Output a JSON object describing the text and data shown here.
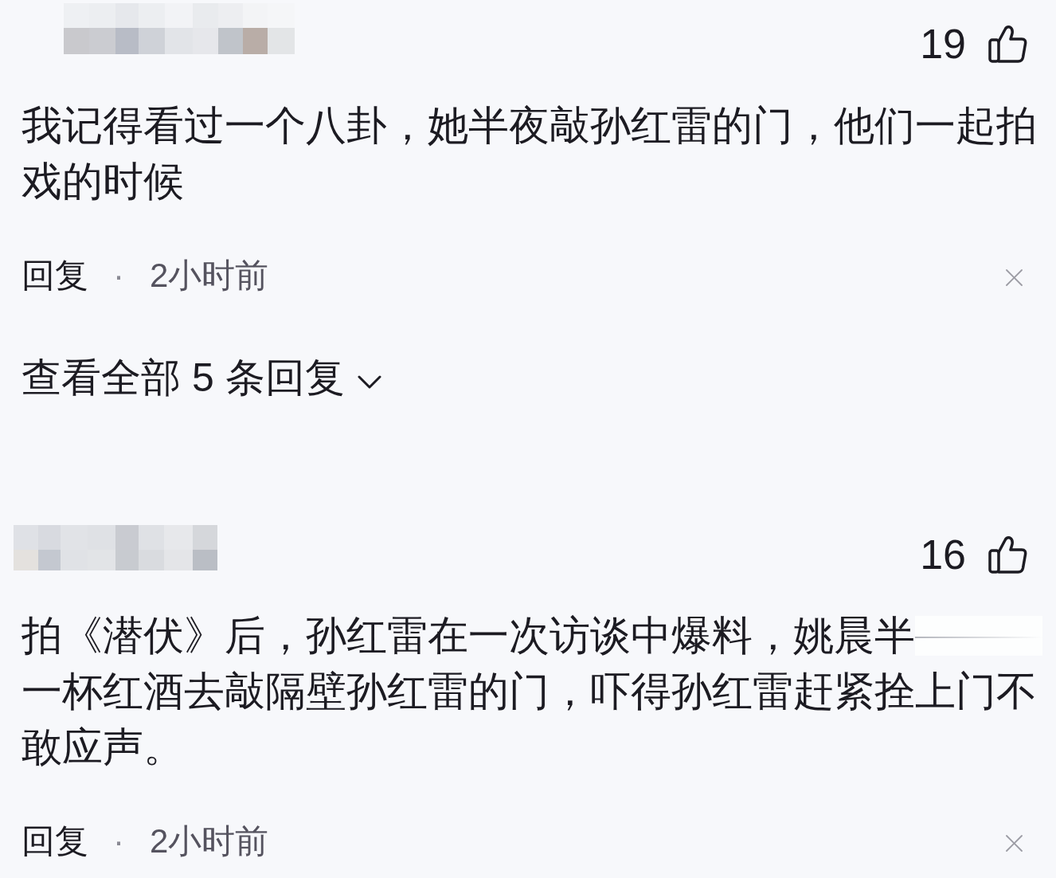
{
  "comments": [
    {
      "likes": "19",
      "body": [
        {
          "kind": "text",
          "text": "我记得看过一个八卦，她半夜敲孙红雷的门，他们一起拍戏的时候"
        }
      ],
      "reply_label": "回复",
      "separator": "·",
      "time": "2小时前",
      "replies_link": "查看全部 5 条回复"
    },
    {
      "likes": "16",
      "body": [
        {
          "kind": "text",
          "text": "拍《潜伏》后，孙红雷在一次访谈中爆料，姚晨半"
        },
        {
          "kind": "redacted"
        },
        {
          "kind": "text",
          "text": "一杯红酒去敲隔壁孙红雷的门，吓得孙红雷赶紧拴上门不敢应声。"
        }
      ],
      "reply_label": "回复",
      "separator": "·",
      "time": "2小时前"
    }
  ]
}
